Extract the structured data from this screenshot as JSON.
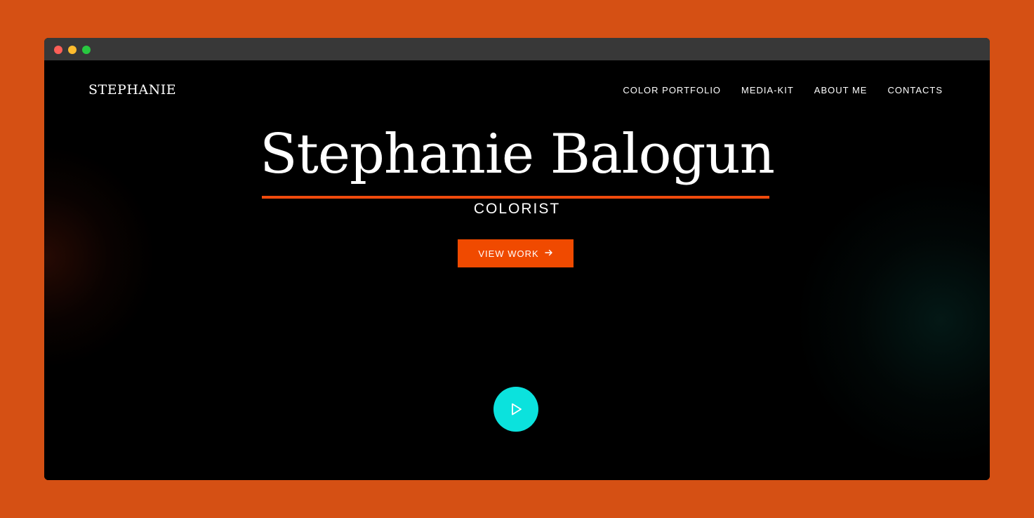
{
  "brand": {
    "logo_text": "STEPHANIE"
  },
  "nav": {
    "items": [
      {
        "label": "COLOR PORTFOLIO"
      },
      {
        "label": "MEDIA-KIT"
      },
      {
        "label": "ABOUT ME"
      },
      {
        "label": "CONTACTS"
      }
    ]
  },
  "hero": {
    "title": "Stephanie Balogun",
    "subtitle": "COLORIST",
    "cta_label": "VIEW WORK",
    "cta_icon": "arrow-right-icon",
    "play_icon": "play-icon"
  },
  "colors": {
    "page_background": "#d55014",
    "accent": "#f04a00",
    "play_button": "#0be2dd",
    "site_background": "#000000",
    "text": "#ffffff"
  }
}
